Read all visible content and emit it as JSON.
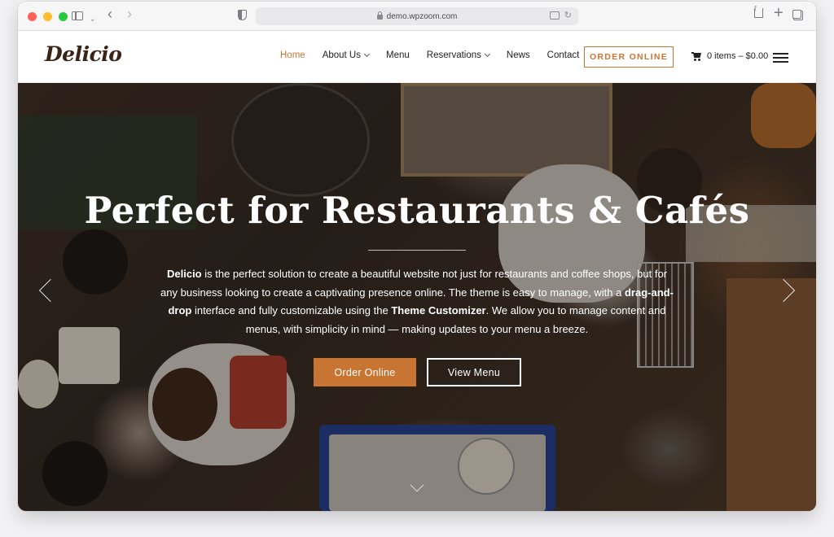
{
  "browser": {
    "url": "demo.wpzoom.com"
  },
  "header": {
    "logo": "Delicio",
    "nav": [
      {
        "label": "Home",
        "active": true,
        "dropdown": false
      },
      {
        "label": "About Us",
        "active": false,
        "dropdown": true
      },
      {
        "label": "Menu",
        "active": false,
        "dropdown": false
      },
      {
        "label": "Reservations",
        "active": false,
        "dropdown": true
      },
      {
        "label": "News",
        "active": false,
        "dropdown": false
      },
      {
        "label": "Contact",
        "active": false,
        "dropdown": false
      }
    ],
    "order_button": "ORDER ONLINE",
    "cart": "0 items – $0.00"
  },
  "hero": {
    "title": "Perfect for Restaurants & Cafés",
    "desc_brand": "Delicio",
    "desc_part1": " is the perfect solution to create a beautiful website not just for restaurants and coffee shops, but for any business looking to create a captivating presence online. The theme is easy to manage, with a ",
    "desc_bold1": "drag-and-drop",
    "desc_part2": " interface and fully customizable using the ",
    "desc_bold2": "Theme Customizer",
    "desc_part3": ". We allow you to manage content and menus, with simplicity in mind — making updates to your menu a breeze.",
    "btn_primary": "Order Online",
    "btn_secondary": "View Menu"
  },
  "colors": {
    "accent": "#c87533",
    "logo": "#3a2415"
  }
}
